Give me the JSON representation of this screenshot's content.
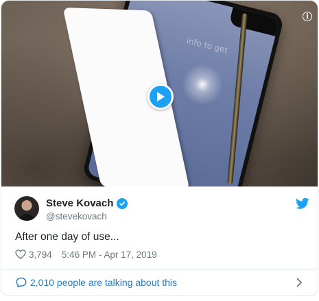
{
  "media": {
    "play_icon": "play-icon",
    "info_icon": "info-icon",
    "phone_ghost_text": "info to get"
  },
  "author": {
    "display_name": "Steve Kovach",
    "handle": "@stevekovach",
    "verified_icon": "verified-badge-icon",
    "avatar": "avatar"
  },
  "tweet": {
    "text": "After one day of use...",
    "like_count": "3,794",
    "timestamp": "5:46 PM - Apr 17, 2019"
  },
  "footer": {
    "talking_label": "2,010 people are talking about this"
  },
  "colors": {
    "accent": "#1da1f2",
    "link": "#2b7bb9",
    "muted": "#697882",
    "text": "#1c2022",
    "border": "#e1e8ed"
  }
}
